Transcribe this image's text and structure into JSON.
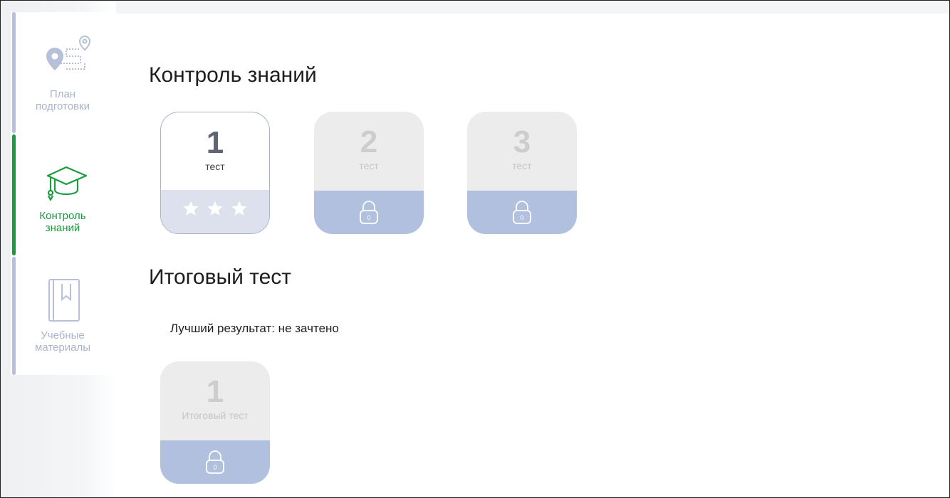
{
  "sidebar": {
    "items": [
      {
        "label": "План\nподготовки",
        "icon": "map-route-icon",
        "active": false
      },
      {
        "label": "Контроль\nзнаний",
        "icon": "graduation-cap-icon",
        "active": true
      },
      {
        "label": "Учебные\nматериалы",
        "icon": "book-bookmark-icon",
        "active": false
      }
    ]
  },
  "knowledge_control": {
    "title": "Контроль знаний",
    "cards": [
      {
        "number": "1",
        "caption": "тест",
        "locked": false,
        "stars": 3,
        "icon": "star-icon"
      },
      {
        "number": "2",
        "caption": "тест",
        "locked": true,
        "lock_count": "0",
        "icon": "lock-icon"
      },
      {
        "number": "3",
        "caption": "тест",
        "locked": true,
        "lock_count": "0",
        "icon": "lock-icon"
      }
    ]
  },
  "final_test": {
    "title": "Итоговый тест",
    "best_result": "Лучший результат: не зачтено",
    "cards": [
      {
        "number": "1",
        "caption": "Итоговый тест",
        "locked": true,
        "lock_count": "0",
        "icon": "lock-icon"
      }
    ]
  },
  "colors": {
    "accent_green": "#1a9b3f",
    "inactive_blue": "#aab4ca",
    "locked_bottom": "#b2c0e0",
    "open_bottom": "#dde1ee"
  }
}
